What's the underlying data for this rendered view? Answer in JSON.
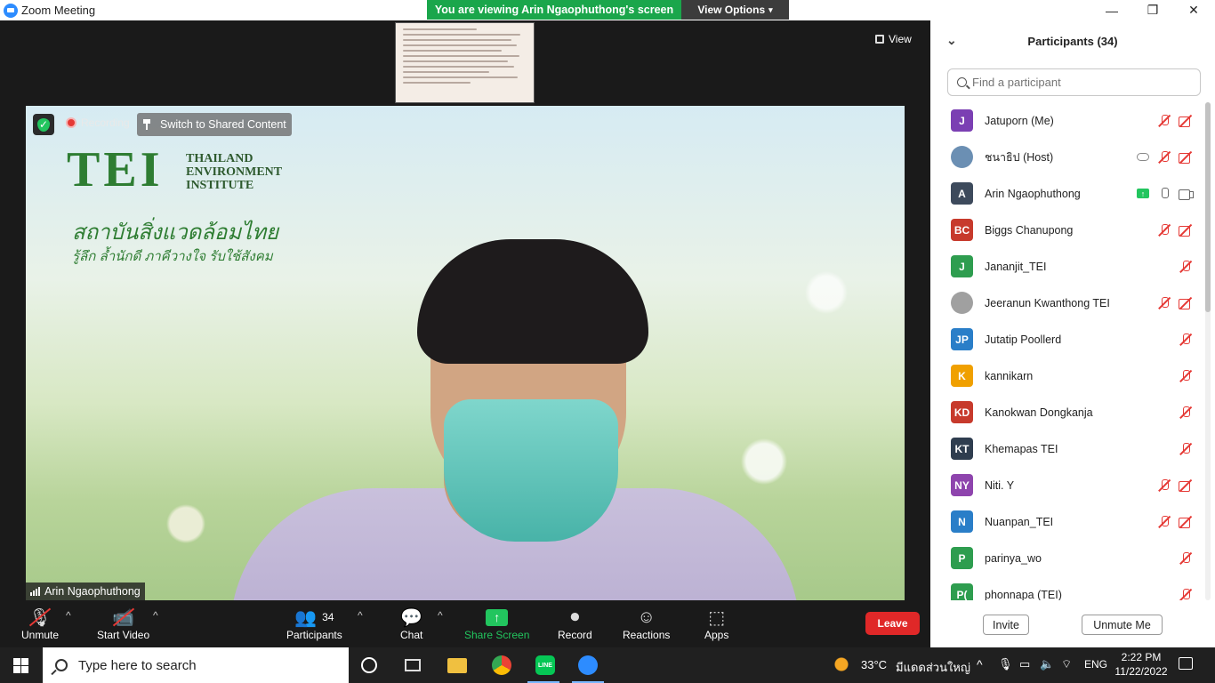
{
  "window": {
    "title": "Zoom Meeting"
  },
  "banner": {
    "viewing_text": "You are viewing Arin Ngaophuthong's screen",
    "view_options": "View Options"
  },
  "stage": {
    "view_label": "View",
    "recording_label": "Recording",
    "switch_label": "Switch to Shared Content",
    "speaker_name": "Arin Ngaophuthong",
    "background": {
      "logo": "TEI",
      "logo_sub": [
        "THAILAND",
        "ENVIRONMENT",
        "INSTITUTE"
      ],
      "thai_line_1": "สถาบันสิ่งแวดล้อมไทย",
      "thai_line_2": "รู้ลึก ล้ำนักดี ภาคีวางใจ รับใช้สังคม"
    }
  },
  "toolbar": {
    "unmute": "Unmute",
    "start_video": "Start Video",
    "participants": "Participants",
    "participants_count": "34",
    "chat": "Chat",
    "share_screen": "Share Screen",
    "record": "Record",
    "reactions": "Reactions",
    "apps": "Apps",
    "leave": "Leave"
  },
  "panel": {
    "title": "Participants (34)",
    "search_placeholder": "Find a participant",
    "invite": "Invite",
    "unmute_me": "Unmute Me",
    "participants": [
      {
        "initials": "J",
        "name": "Jatuporn (Me)",
        "color": "#7b3fb3",
        "mic": "muted",
        "cam": "off"
      },
      {
        "initials": "",
        "name": "ชนาธิป (Host)",
        "color": "#6b8fb3",
        "mic": "muted",
        "cam": "off",
        "cloud": true,
        "photo": true
      },
      {
        "initials": "A",
        "name": "Arin Ngaophuthong",
        "color": "#3d4a5c",
        "mic": "on",
        "cam": "on",
        "sharing": true
      },
      {
        "initials": "BC",
        "name": "Biggs Chanupong",
        "color": "#c73a2c",
        "mic": "muted",
        "cam": "off"
      },
      {
        "initials": "J",
        "name": "Jananjit_TEI",
        "color": "#2e9d4f",
        "mic": "muted",
        "cam": "none"
      },
      {
        "initials": "",
        "name": "Jeeranun Kwanthong TEI",
        "color": "#a0a0a0",
        "mic": "muted",
        "cam": "off",
        "photo": true
      },
      {
        "initials": "JP",
        "name": "Jutatip  Poollerd",
        "color": "#2a7ec8",
        "mic": "muted",
        "cam": "none"
      },
      {
        "initials": "K",
        "name": "kannikarn",
        "color": "#f0a000",
        "mic": "muted",
        "cam": "none"
      },
      {
        "initials": "KD",
        "name": "Kanokwan Dongkanja",
        "color": "#c73a2c",
        "mic": "muted",
        "cam": "none"
      },
      {
        "initials": "KT",
        "name": "Khemapas TEI",
        "color": "#2f3d4f",
        "mic": "muted",
        "cam": "none"
      },
      {
        "initials": "NY",
        "name": "Niti. Y",
        "color": "#8e44ad",
        "mic": "muted",
        "cam": "off"
      },
      {
        "initials": "N",
        "name": "Nuanpan_TEI",
        "color": "#2a7ec8",
        "mic": "muted",
        "cam": "off"
      },
      {
        "initials": "P",
        "name": "parinya_wo",
        "color": "#2e9d4f",
        "mic": "muted",
        "cam": "none"
      },
      {
        "initials": "P(",
        "name": "phonnapa (TEI)",
        "color": "#2e9d4f",
        "mic": "muted",
        "cam": "none"
      }
    ]
  },
  "taskbar": {
    "search_placeholder": "Type here to search",
    "temperature": "33°C",
    "weather": "มีแดดส่วนใหญ่",
    "language": "ENG",
    "time": "2:22 PM",
    "date": "11/22/2022"
  }
}
